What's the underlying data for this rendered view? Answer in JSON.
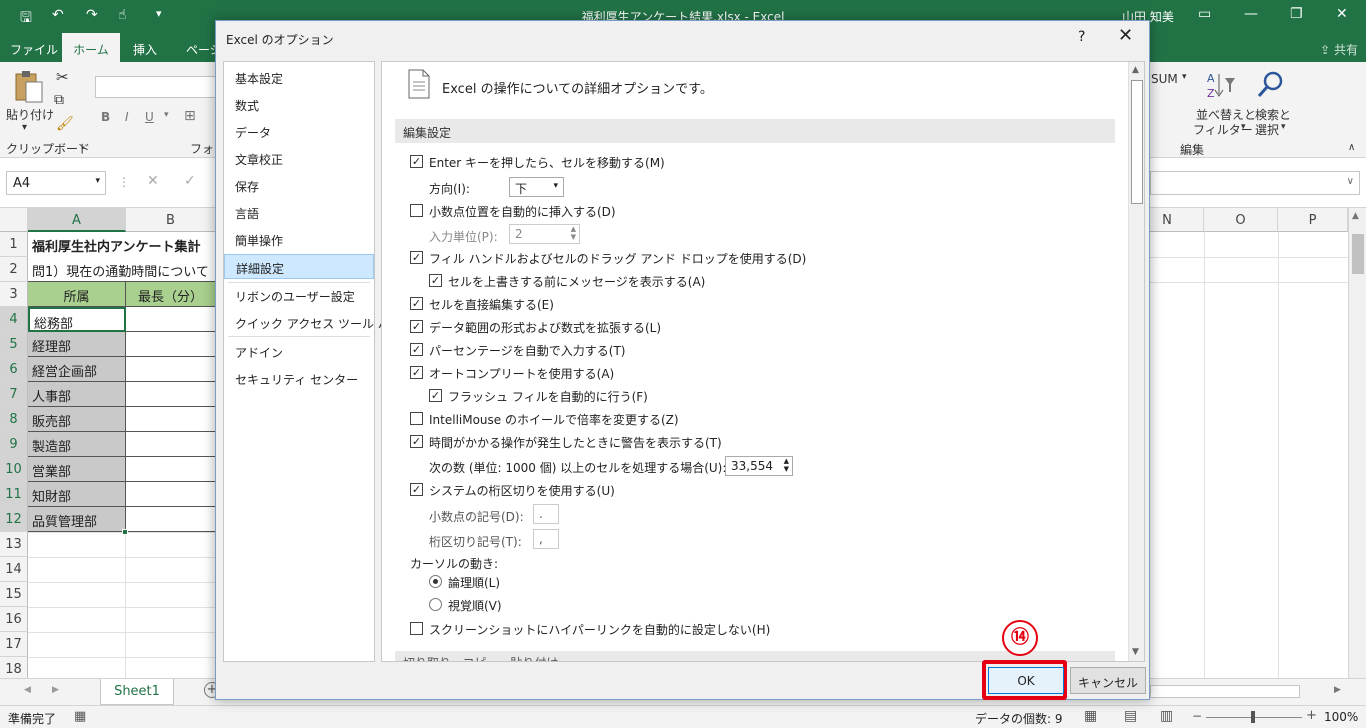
{
  "window": {
    "title": "福利厚生アンケート結果.xlsx  -  Excel",
    "user": "山田 知美",
    "share": "共有"
  },
  "tabs": [
    "ファイル",
    "ホーム",
    "挿入",
    "ページ"
  ],
  "ribbon": {
    "paste_label": "貼り付け",
    "clipboard_label": "クリップボード",
    "font_label": "フォン",
    "bold": "B",
    "italic": "I",
    "underline": "U",
    "sum": "SUM",
    "sort_label_1": "並べ替えと",
    "sort_label_2": "フィルター",
    "find_label_1": "検索と",
    "find_label_2": "選択",
    "edit_label": "編集"
  },
  "formula_bar": {
    "name_box": "A4"
  },
  "columns_left": [
    "A",
    "B"
  ],
  "columns_right": [
    "N",
    "O",
    "P"
  ],
  "rows": [
    "1",
    "2",
    "3",
    "4",
    "5",
    "6",
    "7",
    "8",
    "9",
    "10",
    "11",
    "12",
    "13",
    "14",
    "15",
    "16",
    "17",
    "18"
  ],
  "cells": {
    "a1": "福利厚生社内アンケート集計",
    "a2": "問1）現在の通勤時間について",
    "a3": "所属",
    "b3": "最長（分）",
    "departments": [
      "総務部",
      "経理部",
      "経営企画部",
      "人事部",
      "販売部",
      "製造部",
      "営業部",
      "知財部",
      "品質管理部"
    ]
  },
  "sheet_tab": "Sheet1",
  "status": {
    "ready": "準備完了",
    "count": "データの個数: 9",
    "zoom": "100%"
  },
  "dialog": {
    "title": "Excel のオプション",
    "help": "?",
    "nav": [
      "基本設定",
      "数式",
      "データ",
      "文章校正",
      "保存",
      "言語",
      "簡単操作",
      "詳細設定",
      "リボンのユーザー設定",
      "クイック アクセス ツール バー",
      "アドイン",
      "セキュリティ センター"
    ],
    "selected_nav": "詳細設定",
    "header_text": "Excel の操作についての詳細オプションです。",
    "section_edit": "編集設定",
    "options": {
      "enter_move": "Enter キーを押したら、セルを移動する(M)",
      "direction_label": "方向(I):",
      "direction_value": "下",
      "auto_decimal": "小数点位置を自動的に挿入する(D)",
      "input_unit_label": "入力単位(P):",
      "input_unit_value": "2",
      "fill_handle": "フィル ハンドルおよびセルのドラッグ アンド ドロップを使用する(D)",
      "overwrite_alert": "セルを上書きする前にメッセージを表示する(A)",
      "direct_edit": "セルを直接編集する(E)",
      "extend_formats": "データ範囲の形式および数式を拡張する(L)",
      "auto_percent": "パーセンテージを自動で入力する(T)",
      "autocomplete": "オートコンプリートを使用する(A)",
      "flash_fill": "フラッシュ フィルを自動的に行う(F)",
      "intellimouse": "IntelliMouse のホイールで倍率を変更する(Z)",
      "slow_alert": "時間がかかる操作が発生したときに警告を表示する(T)",
      "cells_threshold_label": "次の数 (単位: 1000 個) 以上のセルを処理する場合(U):",
      "cells_threshold_value": "33,554",
      "system_separators": "システムの桁区切りを使用する(U)",
      "decimal_symbol_label": "小数点の記号(D):",
      "decimal_symbol_value": ".",
      "thousands_symbol_label": "桁区切り記号(T):",
      "thousands_symbol_value": ",",
      "cursor_movement": "カーソルの動き:",
      "logical": "論理順(L)",
      "visual": "視覚順(V)",
      "no_hyperlink": "スクリーンショットにハイパーリンクを自動的に設定しない(H)"
    },
    "section_cut": "切り取り、コピー、貼り付け",
    "ok": "OK",
    "cancel": "キャンセル",
    "step_marker": "⑭"
  }
}
